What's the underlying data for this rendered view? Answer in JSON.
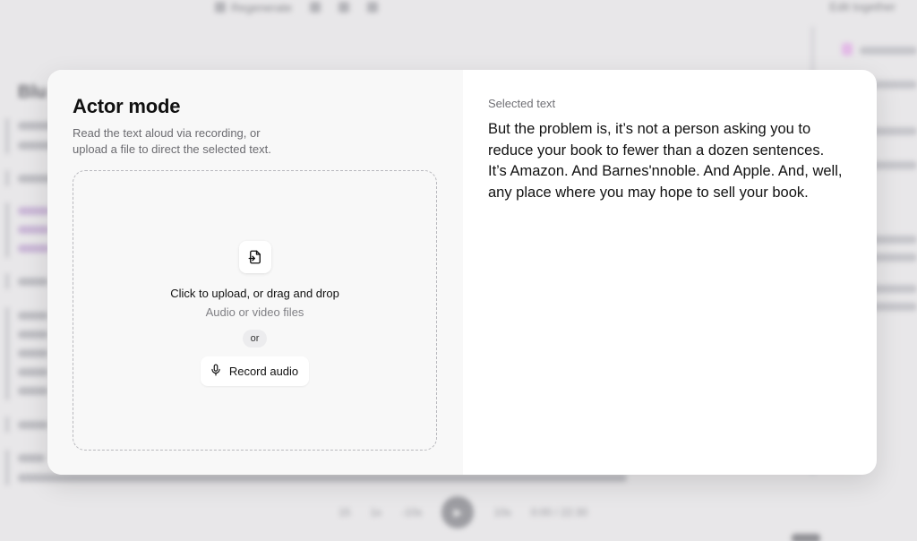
{
  "background": {
    "toolbar": {
      "item_label": "Regenerate",
      "collab_label": "Edit together"
    },
    "doc": {
      "heading": "Blu"
    },
    "player": {
      "speed": "1x",
      "rewind": "-10s",
      "forward": "10s",
      "time": "0:00 / 22:30",
      "back": "15"
    }
  },
  "modal": {
    "title": "Actor mode",
    "subtitle": "Read the text aloud via recording, or upload a file to direct the selected text.",
    "upload": {
      "icon": "file-import-icon",
      "title": "Click to upload, or drag and drop",
      "subtitle": "Audio or video files"
    },
    "or_label": "or",
    "record_button": {
      "icon": "microphone-icon",
      "label": "Record audio"
    },
    "selected": {
      "label": "Selected text",
      "text": "But the problem is, it’s not a person asking you to reduce your book to fewer than a dozen sentences. It’s Amazon. And Barnes'nnoble. And Apple. And, well, any place where you may hope to sell your book."
    }
  },
  "colors": {
    "overlay": "#e8e7e9",
    "left_pane": "#f8f8f8",
    "card": "#ffffff",
    "text": "#111111",
    "muted": "#6b6b70"
  }
}
